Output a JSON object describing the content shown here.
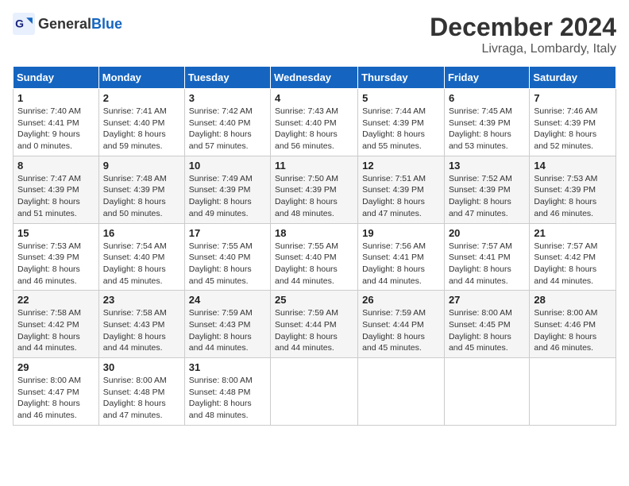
{
  "header": {
    "logo_general": "General",
    "logo_blue": "Blue",
    "month_title": "December 2024",
    "location": "Livraga, Lombardy, Italy"
  },
  "weekdays": [
    "Sunday",
    "Monday",
    "Tuesday",
    "Wednesday",
    "Thursday",
    "Friday",
    "Saturday"
  ],
  "weeks": [
    [
      {
        "day": "1",
        "sunrise": "7:40 AM",
        "sunset": "4:41 PM",
        "daylight": "9 hours and 0 minutes."
      },
      {
        "day": "2",
        "sunrise": "7:41 AM",
        "sunset": "4:40 PM",
        "daylight": "8 hours and 59 minutes."
      },
      {
        "day": "3",
        "sunrise": "7:42 AM",
        "sunset": "4:40 PM",
        "daylight": "8 hours and 57 minutes."
      },
      {
        "day": "4",
        "sunrise": "7:43 AM",
        "sunset": "4:40 PM",
        "daylight": "8 hours and 56 minutes."
      },
      {
        "day": "5",
        "sunrise": "7:44 AM",
        "sunset": "4:39 PM",
        "daylight": "8 hours and 55 minutes."
      },
      {
        "day": "6",
        "sunrise": "7:45 AM",
        "sunset": "4:39 PM",
        "daylight": "8 hours and 53 minutes."
      },
      {
        "day": "7",
        "sunrise": "7:46 AM",
        "sunset": "4:39 PM",
        "daylight": "8 hours and 52 minutes."
      }
    ],
    [
      {
        "day": "8",
        "sunrise": "7:47 AM",
        "sunset": "4:39 PM",
        "daylight": "8 hours and 51 minutes."
      },
      {
        "day": "9",
        "sunrise": "7:48 AM",
        "sunset": "4:39 PM",
        "daylight": "8 hours and 50 minutes."
      },
      {
        "day": "10",
        "sunrise": "7:49 AM",
        "sunset": "4:39 PM",
        "daylight": "8 hours and 49 minutes."
      },
      {
        "day": "11",
        "sunrise": "7:50 AM",
        "sunset": "4:39 PM",
        "daylight": "8 hours and 48 minutes."
      },
      {
        "day": "12",
        "sunrise": "7:51 AM",
        "sunset": "4:39 PM",
        "daylight": "8 hours and 47 minutes."
      },
      {
        "day": "13",
        "sunrise": "7:52 AM",
        "sunset": "4:39 PM",
        "daylight": "8 hours and 47 minutes."
      },
      {
        "day": "14",
        "sunrise": "7:53 AM",
        "sunset": "4:39 PM",
        "daylight": "8 hours and 46 minutes."
      }
    ],
    [
      {
        "day": "15",
        "sunrise": "7:53 AM",
        "sunset": "4:39 PM",
        "daylight": "8 hours and 46 minutes."
      },
      {
        "day": "16",
        "sunrise": "7:54 AM",
        "sunset": "4:40 PM",
        "daylight": "8 hours and 45 minutes."
      },
      {
        "day": "17",
        "sunrise": "7:55 AM",
        "sunset": "4:40 PM",
        "daylight": "8 hours and 45 minutes."
      },
      {
        "day": "18",
        "sunrise": "7:55 AM",
        "sunset": "4:40 PM",
        "daylight": "8 hours and 44 minutes."
      },
      {
        "day": "19",
        "sunrise": "7:56 AM",
        "sunset": "4:41 PM",
        "daylight": "8 hours and 44 minutes."
      },
      {
        "day": "20",
        "sunrise": "7:57 AM",
        "sunset": "4:41 PM",
        "daylight": "8 hours and 44 minutes."
      },
      {
        "day": "21",
        "sunrise": "7:57 AM",
        "sunset": "4:42 PM",
        "daylight": "8 hours and 44 minutes."
      }
    ],
    [
      {
        "day": "22",
        "sunrise": "7:58 AM",
        "sunset": "4:42 PM",
        "daylight": "8 hours and 44 minutes."
      },
      {
        "day": "23",
        "sunrise": "7:58 AM",
        "sunset": "4:43 PM",
        "daylight": "8 hours and 44 minutes."
      },
      {
        "day": "24",
        "sunrise": "7:59 AM",
        "sunset": "4:43 PM",
        "daylight": "8 hours and 44 minutes."
      },
      {
        "day": "25",
        "sunrise": "7:59 AM",
        "sunset": "4:44 PM",
        "daylight": "8 hours and 44 minutes."
      },
      {
        "day": "26",
        "sunrise": "7:59 AM",
        "sunset": "4:44 PM",
        "daylight": "8 hours and 45 minutes."
      },
      {
        "day": "27",
        "sunrise": "8:00 AM",
        "sunset": "4:45 PM",
        "daylight": "8 hours and 45 minutes."
      },
      {
        "day": "28",
        "sunrise": "8:00 AM",
        "sunset": "4:46 PM",
        "daylight": "8 hours and 46 minutes."
      }
    ],
    [
      {
        "day": "29",
        "sunrise": "8:00 AM",
        "sunset": "4:47 PM",
        "daylight": "8 hours and 46 minutes."
      },
      {
        "day": "30",
        "sunrise": "8:00 AM",
        "sunset": "4:48 PM",
        "daylight": "8 hours and 47 minutes."
      },
      {
        "day": "31",
        "sunrise": "8:00 AM",
        "sunset": "4:48 PM",
        "daylight": "8 hours and 48 minutes."
      },
      null,
      null,
      null,
      null
    ]
  ],
  "labels": {
    "sunrise": "Sunrise:",
    "sunset": "Sunset:",
    "daylight": "Daylight:"
  }
}
